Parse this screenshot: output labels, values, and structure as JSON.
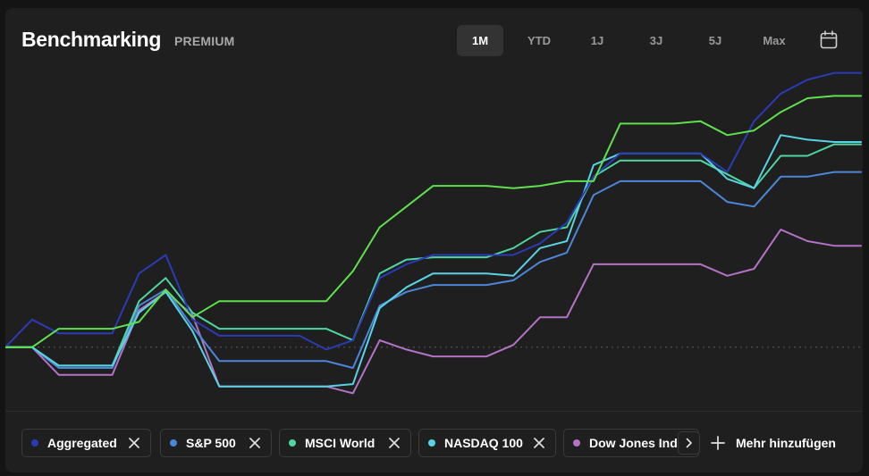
{
  "header": {
    "title": "Benchmarking",
    "badge": "PREMIUM"
  },
  "tabs": [
    {
      "label": "1M",
      "active": true
    },
    {
      "label": "YTD",
      "active": false
    },
    {
      "label": "1J",
      "active": false
    },
    {
      "label": "3J",
      "active": false
    },
    {
      "label": "5J",
      "active": false
    },
    {
      "label": "Max",
      "active": false
    }
  ],
  "calendar_icon": "calendar-icon",
  "legend": {
    "items": [
      {
        "label": "Aggregated",
        "color": "#2a3bb5"
      },
      {
        "label": "S&P 500",
        "color": "#4d86d8"
      },
      {
        "label": "MSCI World",
        "color": "#4fd6a0"
      },
      {
        "label": "NASDAQ 100",
        "color": "#5ad2e6"
      },
      {
        "label": "Dow Jones Indu",
        "color": "#b472c6"
      }
    ],
    "add_label": "Mehr hinzufügen"
  },
  "chart_data": {
    "type": "line",
    "x": [
      0,
      1,
      2,
      3,
      4,
      5,
      6,
      7,
      8,
      9,
      10,
      11,
      12,
      13,
      14,
      15,
      16,
      17,
      18,
      19,
      20,
      21,
      22,
      23,
      24,
      25,
      26,
      27,
      28,
      29,
      30,
      31,
      32
    ],
    "baseline": 0,
    "ylim": [
      -2.1,
      12.0
    ],
    "grid": false,
    "series": [
      {
        "name": "Aggregated",
        "color": "#2a3bb5",
        "values": [
          0,
          1.2,
          0.6,
          0.6,
          0.6,
          3.2,
          4.0,
          1.2,
          0.5,
          0.5,
          0.5,
          0.5,
          -0.1,
          0.3,
          3.0,
          3.6,
          4.0,
          4.0,
          4.0,
          4.0,
          4.5,
          5.4,
          7.4,
          8.4,
          8.4,
          8.4,
          8.4,
          7.6,
          9.8,
          11.0,
          11.6,
          11.9,
          11.9
        ]
      },
      {
        "name": "S&P 500",
        "color": "#4d86d8",
        "values": [
          0,
          0,
          -0.9,
          -0.9,
          -0.9,
          1.8,
          2.5,
          0.9,
          -0.6,
          -0.6,
          -0.6,
          -0.6,
          -0.6,
          -0.9,
          1.8,
          2.4,
          2.7,
          2.7,
          2.7,
          2.9,
          3.7,
          4.1,
          6.6,
          7.2,
          7.2,
          7.2,
          7.2,
          6.3,
          6.1,
          7.4,
          7.4,
          7.6,
          7.6
        ]
      },
      {
        "name": "MSCI World",
        "color": "#4fd6a0",
        "values": [
          0,
          0,
          -0.8,
          -0.8,
          -0.8,
          2.0,
          3.0,
          1.5,
          0.8,
          0.8,
          0.8,
          0.8,
          0.8,
          0.3,
          3.2,
          3.8,
          3.9,
          3.9,
          3.9,
          4.3,
          5.0,
          5.2,
          7.4,
          8.1,
          8.1,
          8.1,
          8.1,
          7.5,
          6.9,
          8.3,
          8.3,
          8.8,
          8.8
        ]
      },
      {
        "name": "NASDAQ 100",
        "color": "#5ad2e6",
        "values": [
          0,
          0,
          -0.8,
          -0.8,
          -0.8,
          1.5,
          2.4,
          0.7,
          -1.7,
          -1.7,
          -1.7,
          -1.7,
          -1.7,
          -1.6,
          1.7,
          2.6,
          3.2,
          3.2,
          3.2,
          3.1,
          4.3,
          4.6,
          7.9,
          8.4,
          8.4,
          8.4,
          8.4,
          7.3,
          6.9,
          9.2,
          9.0,
          8.9,
          8.9
        ]
      },
      {
        "name": "Dow Jones Indu",
        "color": "#b472c6",
        "values": [
          0,
          0,
          -1.2,
          -1.2,
          -1.2,
          1.6,
          2.4,
          1.4,
          -1.7,
          -1.7,
          -1.7,
          -1.7,
          -1.7,
          -2.0,
          0.3,
          -0.1,
          -0.4,
          -0.4,
          -0.4,
          0.1,
          1.3,
          1.3,
          3.6,
          3.6,
          3.6,
          3.6,
          3.6,
          3.1,
          3.4,
          5.1,
          4.6,
          4.4,
          4.4
        ]
      },
      {
        "name": "",
        "color": "#5ee14d",
        "values": [
          0,
          0,
          0.8,
          0.8,
          0.8,
          1.1,
          2.5,
          1.3,
          2.0,
          2.0,
          2.0,
          2.0,
          2.0,
          3.3,
          5.2,
          6.1,
          7.0,
          7.0,
          7.0,
          6.9,
          7.0,
          7.2,
          7.2,
          9.7,
          9.7,
          9.7,
          9.8,
          9.2,
          9.4,
          10.2,
          10.8,
          10.9,
          10.9
        ]
      }
    ]
  }
}
